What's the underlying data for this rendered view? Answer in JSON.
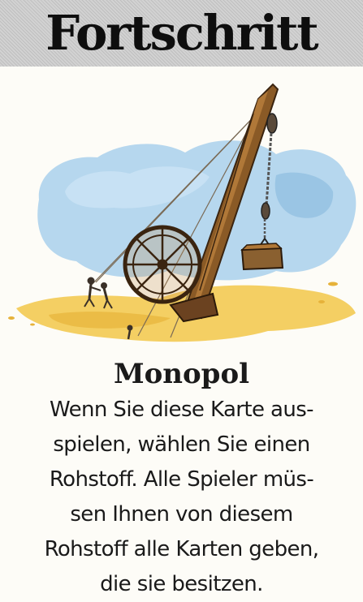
{
  "card": {
    "category": "Fortschritt",
    "name": "Monopol",
    "text_lines": [
      "Wenn Sie diese Karte aus-",
      "spielen, wählen Sie einen",
      "Rohstoff. Alle Spieler müs-",
      "sen Ihnen von diesem",
      "Rohstoff alle Karten geben,",
      "die sie besitzen."
    ],
    "illustration": "wooden-crane-icon"
  },
  "colors": {
    "banner_bg": "#d2d2d2",
    "sky": "#9ec9e8",
    "ground": "#f2c95a",
    "wood": "#8a5a26"
  }
}
